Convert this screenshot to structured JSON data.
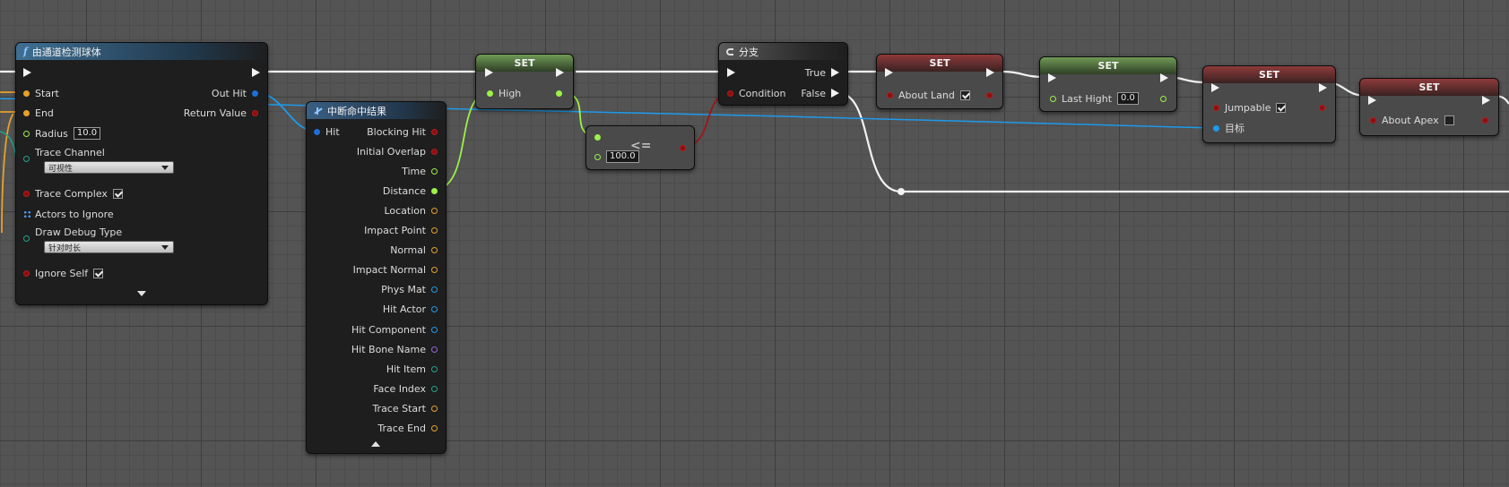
{
  "colors": {
    "exec": "#f2f2f2",
    "float": "#9cf04a",
    "bool": "#8b0f0f",
    "struct": "#e6a12b",
    "object": "#1e9aea",
    "teal": "#1fa68c",
    "purple": "#9a62d6"
  },
  "trace_node": {
    "title": "由通道检测球体",
    "icon": "function-icon",
    "inputs": {
      "start": "Start",
      "end": "End",
      "radius_label": "Radius",
      "radius_value": "10.0",
      "trace_channel_label": "Trace Channel",
      "trace_channel_value": "可视性",
      "trace_complex_label": "Trace Complex",
      "trace_complex_checked": true,
      "actors_label": "Actors to Ignore",
      "draw_debug_label": "Draw Debug Type",
      "draw_debug_value": "针对时长",
      "ignore_self_label": "Ignore Self",
      "ignore_self_checked": true
    },
    "outputs": {
      "out_hit": "Out Hit",
      "return_value": "Return Value"
    }
  },
  "break_node": {
    "title": "中断命中结果",
    "input": "Hit",
    "outputs": [
      "Blocking Hit",
      "Initial Overlap",
      "Time",
      "Distance",
      "Location",
      "Impact Point",
      "Normal",
      "Impact Normal",
      "Phys Mat",
      "Hit Actor",
      "Hit Component",
      "Hit Bone Name",
      "Hit Item",
      "Face Index",
      "Trace Start",
      "Trace End"
    ]
  },
  "set_high": {
    "title": "SET",
    "var": "High"
  },
  "compare_node": {
    "value": "100.0",
    "operator": "<="
  },
  "branch_node": {
    "title": "分支",
    "condition": "Condition",
    "true_label": "True",
    "false_label": "False"
  },
  "set_about_land": {
    "title": "SET",
    "var": "About Land",
    "checked": true
  },
  "set_last_hight": {
    "title": "SET",
    "var": "Last Hight",
    "value": "0.0"
  },
  "set_jumpable": {
    "title": "SET",
    "var": "Jumpable",
    "checked": true,
    "target": "目标"
  },
  "set_about_apex": {
    "title": "SET",
    "var": "About Apex",
    "checked": false
  }
}
